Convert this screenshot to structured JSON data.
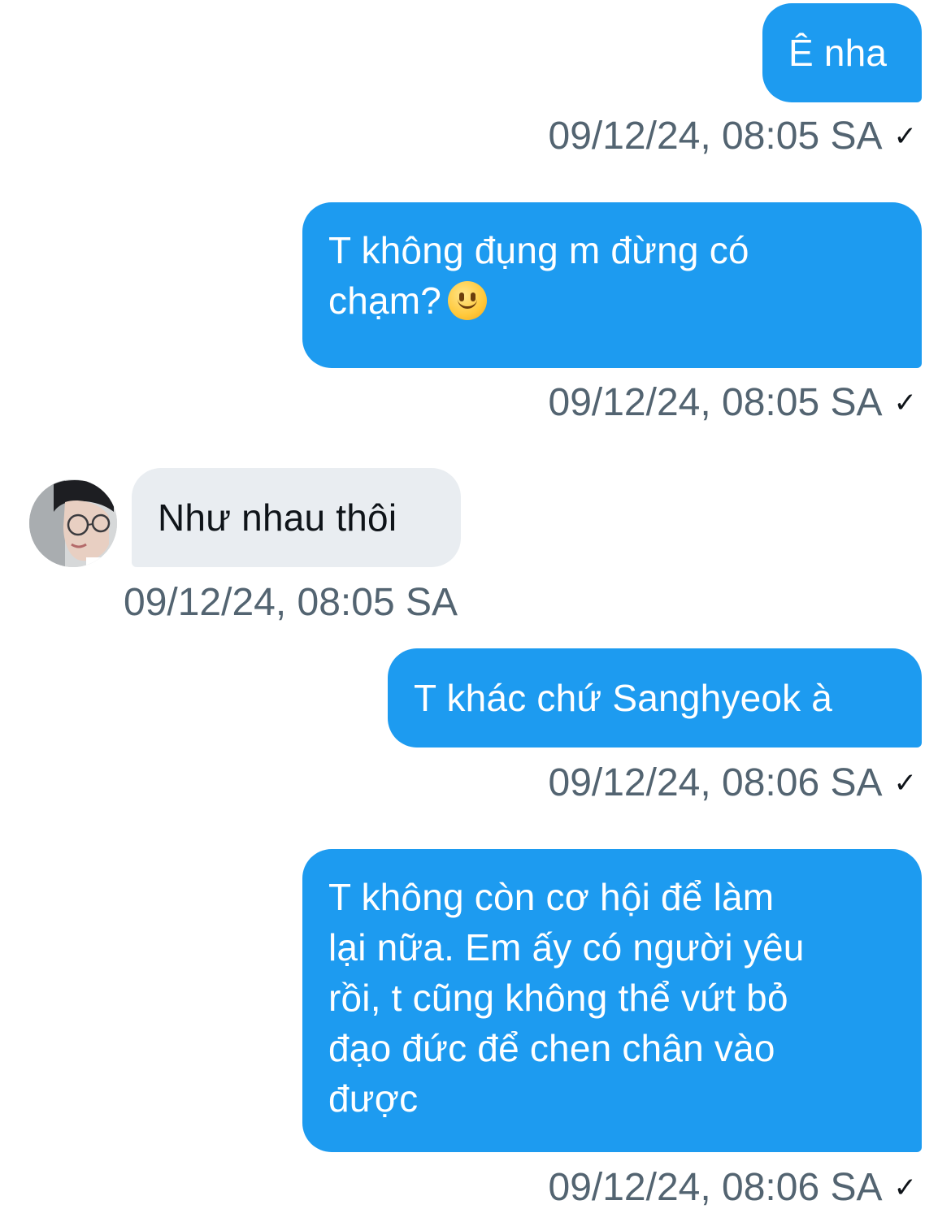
{
  "messages": [
    {
      "direction": "sent",
      "text": "Ê nha",
      "timestamp": "09/12/24, 08:05 SA",
      "status_icon": "checkmark-icon",
      "status_glyph": "✓"
    },
    {
      "direction": "sent",
      "text_line1": "T không đụng m đừng có",
      "text_line2": "chạm?",
      "emoji": "slightly-smiling-face",
      "timestamp": "09/12/24, 08:05 SA",
      "status_icon": "checkmark-icon",
      "status_glyph": "✓"
    },
    {
      "direction": "received",
      "text": "Như nhau thôi",
      "timestamp": "09/12/24, 08:05 SA",
      "avatar": "user-avatar"
    },
    {
      "direction": "sent",
      "text": "T khác chứ Sanghyeok à",
      "timestamp": "09/12/24, 08:06 SA",
      "status_icon": "checkmark-icon",
      "status_glyph": "✓"
    },
    {
      "direction": "sent",
      "lines": [
        "T không còn cơ hội để làm",
        "lại nữa. Em ấy có người yêu",
        "rồi, t cũng không thể vứt bỏ",
        "đạo đức để chen chân vào",
        "được"
      ],
      "timestamp": "09/12/24, 08:06 SA",
      "status_icon": "checkmark-icon",
      "status_glyph": "✓"
    }
  ],
  "colors": {
    "sent_bubble": "#1d9bf0",
    "received_bubble": "#e9edf1",
    "timestamp_text": "#536471",
    "background": "#ffffff"
  }
}
